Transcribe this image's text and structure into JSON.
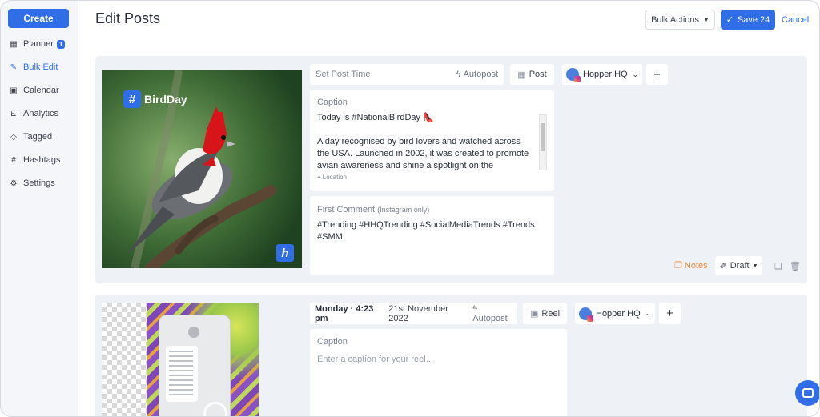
{
  "sidebar": {
    "create_label": "Create",
    "items": [
      {
        "label": "Planner",
        "icon": "grid-icon",
        "badge": "1"
      },
      {
        "label": "Bulk Edit",
        "icon": "edit-icon",
        "active": true
      },
      {
        "label": "Calendar",
        "icon": "calendar-icon"
      },
      {
        "label": "Analytics",
        "icon": "chart-icon"
      },
      {
        "label": "Tagged",
        "icon": "tag-icon"
      },
      {
        "label": "Hashtags",
        "icon": "hashtag-icon"
      },
      {
        "label": "Settings",
        "icon": "gear-icon"
      }
    ]
  },
  "header": {
    "title": "Edit Posts",
    "bulk_actions_label": "Bulk Actions",
    "save_label": "Save 24",
    "cancel_label": "Cancel"
  },
  "posts": [
    {
      "image_tag": "BirdDay",
      "time_placeholder": "Set Post Time",
      "autopost_label": "Autopost",
      "type_label": "Post",
      "account": "Hopper HQ",
      "caption_label": "Caption",
      "caption_line1": "Today is #NationalBirdDay 👠",
      "caption_body": "A day recognised by bird lovers and watched across the USA. Launched in 2002, it was created to promote avian awareness and shine a spotlight on the protection and",
      "location_label": "Location",
      "comment_label": "First Comment",
      "comment_sublabel": "(Instagram only)",
      "comment_text": "#Trending #HHQTrending #SocialMediaTrends #Trends #SMM",
      "notes_label": "Notes",
      "status_label": "Draft"
    },
    {
      "day_time": "Monday · 4:23 pm",
      "date": "21st November 2022",
      "autopost_label": "Autopost",
      "type_label": "Reel",
      "account": "Hopper HQ",
      "caption_label": "Caption",
      "caption_placeholder": "Enter a caption for your reel..."
    }
  ],
  "colors": {
    "accent": "#2f6ee6",
    "notes": "#e8893a",
    "sidebar_bg": "#f4f6fa",
    "card_bg": "#eef1f6"
  }
}
